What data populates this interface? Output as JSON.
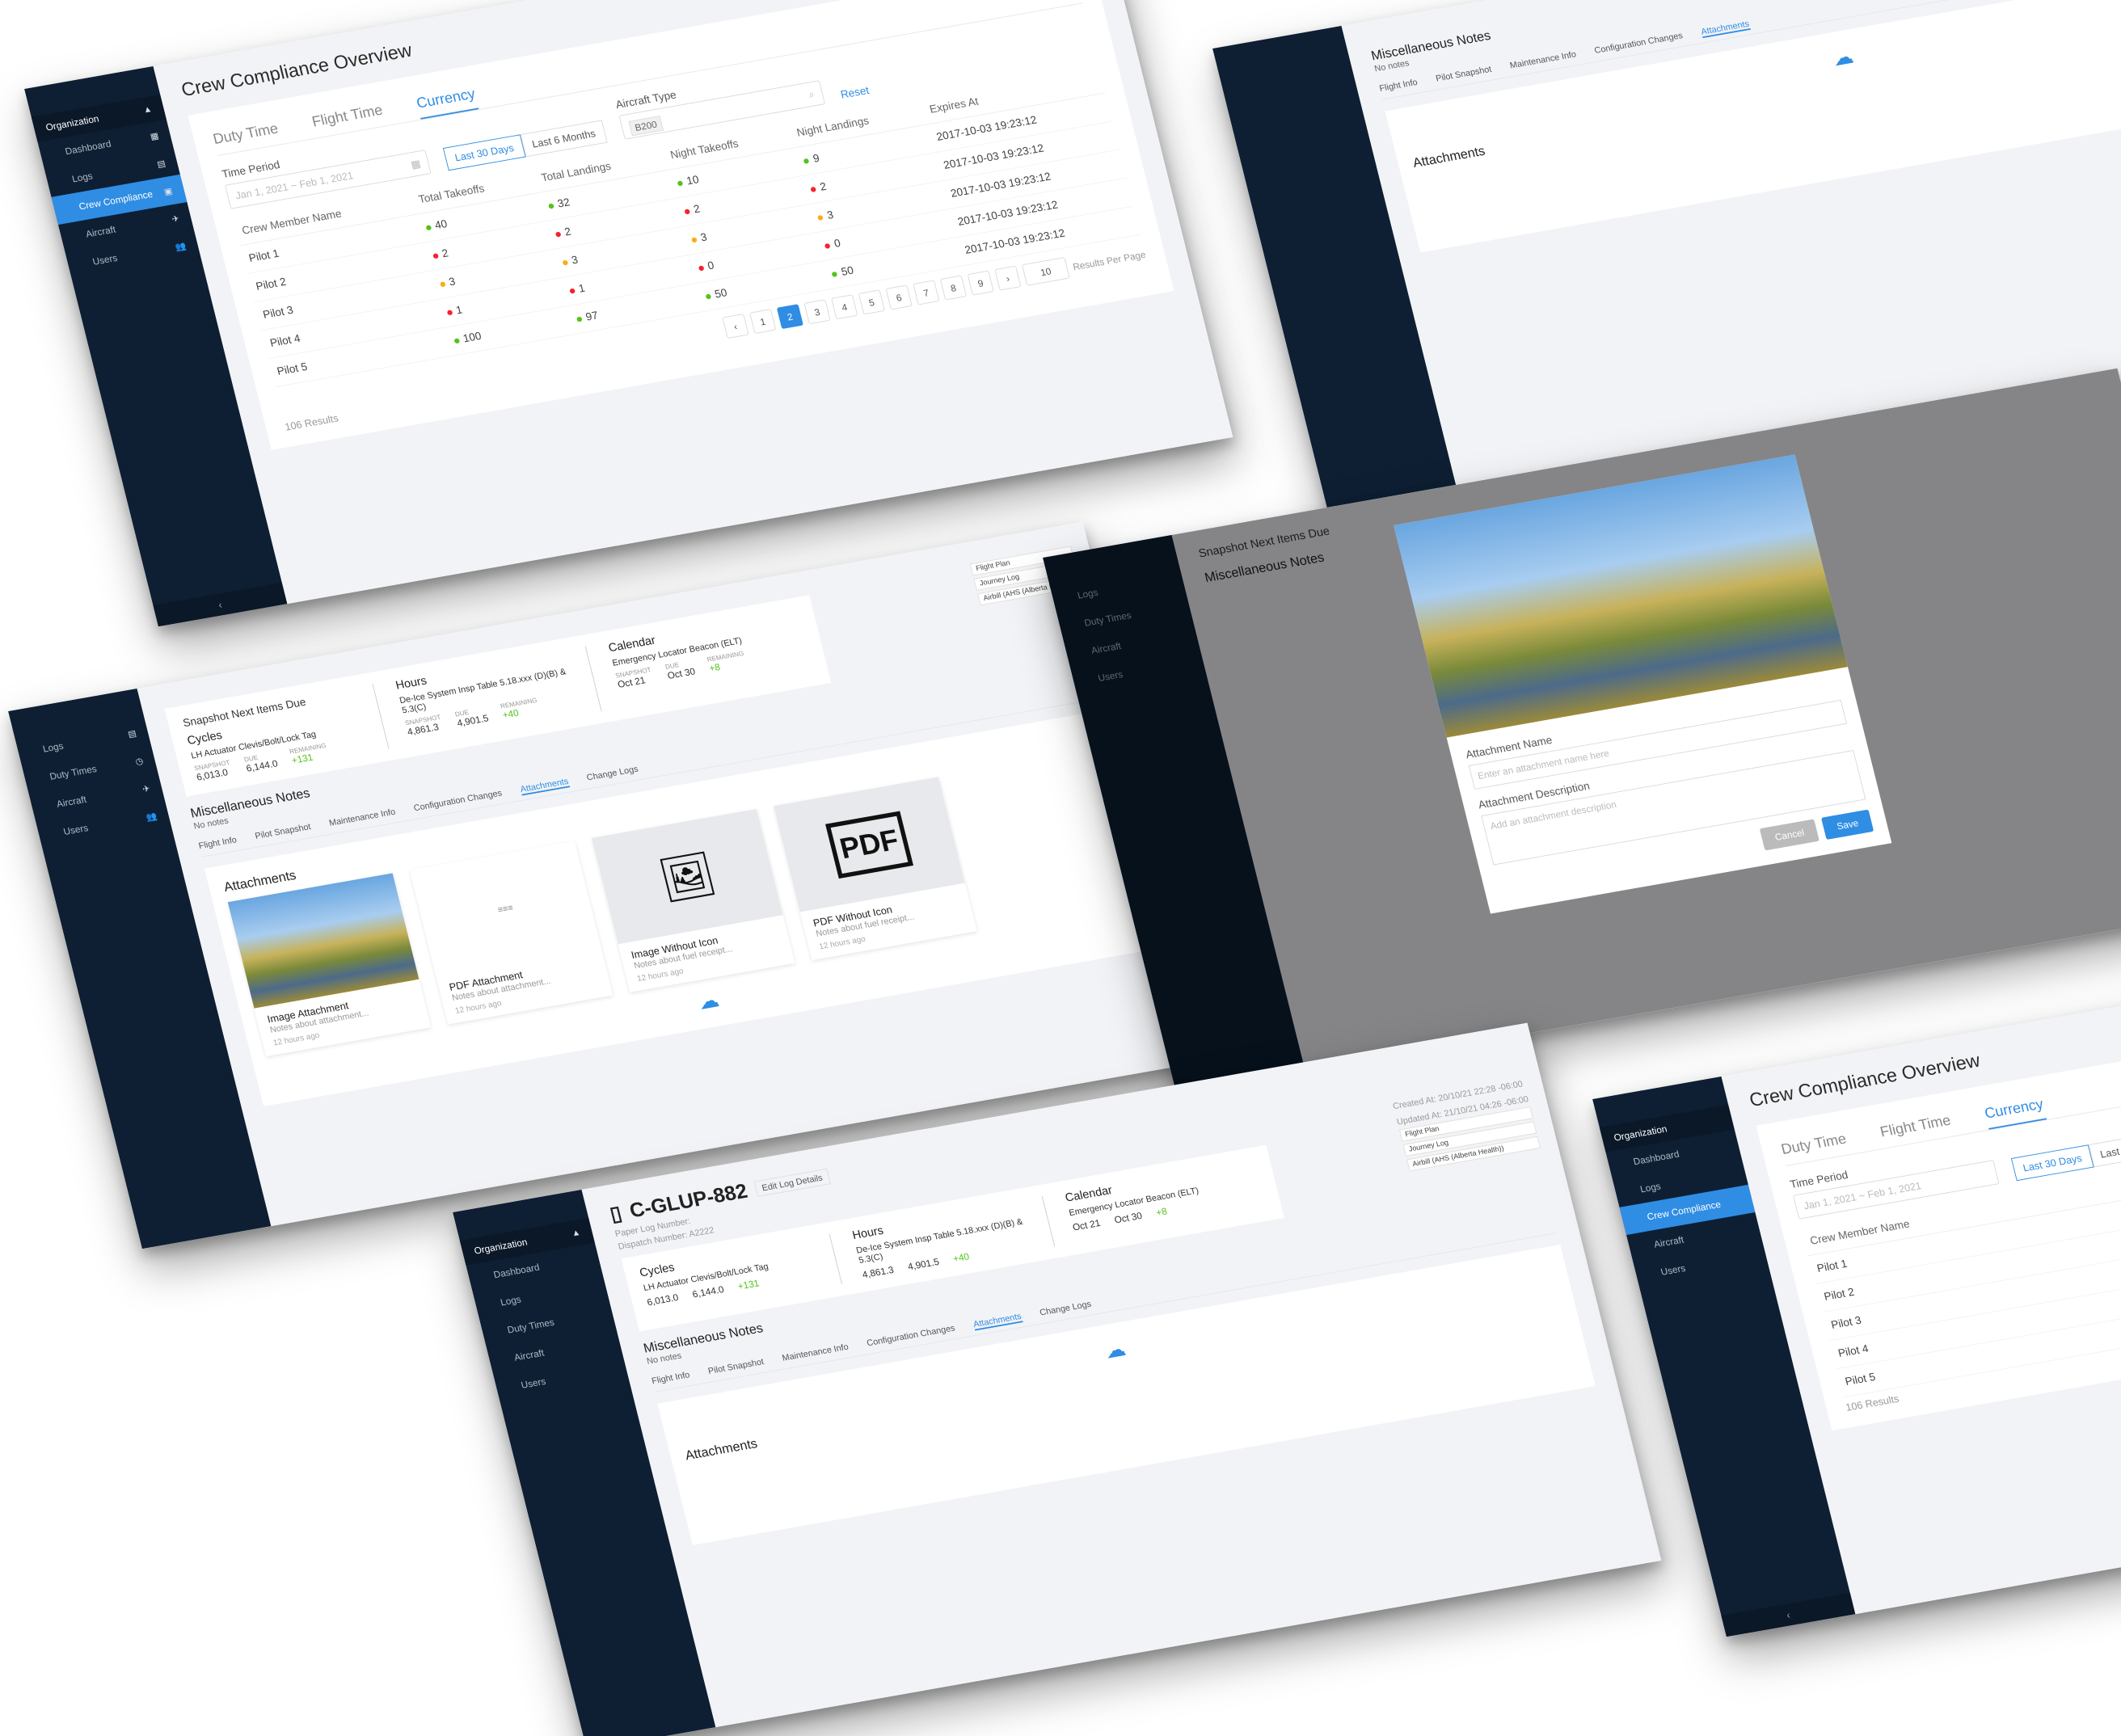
{
  "sidebar": {
    "org": "Organization",
    "items": [
      "Dashboard",
      "Logs",
      "Crew Compliance",
      "Aircraft",
      "Users"
    ],
    "items_log": [
      "Logs",
      "Duty Times",
      "Aircraft",
      "Users"
    ],
    "items_full": [
      "Dashboard",
      "Logs",
      "Duty Times",
      "Aircraft",
      "Users"
    ],
    "collapse": "‹"
  },
  "compliance": {
    "title": "Crew Compliance Overview",
    "tabs": [
      "Duty Time",
      "Flight Time",
      "Currency"
    ],
    "time_period_label": "Time Period",
    "time_period_placeholder": "Jan 1, 2021 ~ Feb 1, 2021",
    "range_options": [
      "Last 30 Days",
      "Last 6 Months"
    ],
    "aircraft_type_label": "Aircraft Type",
    "aircraft_tag": "B200",
    "reset": "Reset",
    "columns": [
      "Crew Member Name",
      "Total Takeoffs",
      "Total Landings",
      "Night Takeoffs",
      "Night Landings",
      "Expires At"
    ],
    "rows": [
      {
        "name": "Pilot 1",
        "takeoffs": "40",
        "tc": "g",
        "landings": "32",
        "lc": "g",
        "nt": "10",
        "ntc": "g",
        "nl": "9",
        "nlc": "g",
        "exp": "2017-10-03 19:23:12"
      },
      {
        "name": "Pilot 2",
        "takeoffs": "2",
        "tc": "r",
        "landings": "2",
        "lc": "r",
        "nt": "2",
        "ntc": "r",
        "nl": "2",
        "nlc": "r",
        "exp": "2017-10-03 19:23:12"
      },
      {
        "name": "Pilot 3",
        "takeoffs": "3",
        "tc": "y",
        "landings": "3",
        "lc": "y",
        "nt": "3",
        "ntc": "y",
        "nl": "3",
        "nlc": "y",
        "exp": "2017-10-03 19:23:12"
      },
      {
        "name": "Pilot 4",
        "takeoffs": "1",
        "tc": "r",
        "landings": "1",
        "lc": "r",
        "nt": "0",
        "ntc": "r",
        "nl": "0",
        "nlc": "r",
        "exp": "2017-10-03 19:23:12"
      },
      {
        "name": "Pilot 5",
        "takeoffs": "100",
        "tc": "g",
        "landings": "97",
        "lc": "g",
        "nt": "50",
        "ntc": "g",
        "nl": "50",
        "nlc": "g",
        "exp": "2017-10-03 19:23:12"
      }
    ],
    "pages": [
      "‹",
      "1",
      "2",
      "3",
      "4",
      "5",
      "6",
      "7",
      "8",
      "9",
      "›"
    ],
    "active_page": "2",
    "per_page": "10",
    "per_page_label": "Results Per Page",
    "results": "106 Results"
  },
  "log": {
    "title": "C-GLUP-882",
    "edit": "Edit Log Details",
    "paper_log": "Paper Log Number:",
    "dispatch": "Dispatch Number: A2222",
    "created": "Created At: 20/10/21 22:28 -06:00",
    "updated": "Updated At: 21/10/21 04:26 -06:00",
    "chips": [
      "Flight Plan",
      "Journey Log",
      "Airbill (AHS (Alberta Health))"
    ],
    "snapshot_title": "Snapshot Next Items Due",
    "cycles": {
      "h": "Cycles",
      "item": "LH Actuator Clevis/Bolt/Lock Tag",
      "snapshot": "6,013.0",
      "due": "6,144.0",
      "remaining": "+131"
    },
    "hours": {
      "h": "Hours",
      "item": "De-Ice System Insp Table 5.18.xxx (D)(B) & 5.3(C)",
      "snapshot": "4,861.3",
      "due": "4,901.5",
      "remaining": "+40"
    },
    "calendar": {
      "h": "Calendar",
      "item": "Emergency Locator Beacon (ELT)",
      "snapshot": "Oct 21",
      "due": "Oct 30",
      "remaining": "+8"
    },
    "lbl_snapshot": "SNAPSHOT",
    "lbl_due": "DUE",
    "lbl_remaining": "REMAINING",
    "notes_h": "Miscellaneous Notes",
    "notes": "No notes",
    "tabs": [
      "Flight Info",
      "Pilot Snapshot",
      "Maintenance Info",
      "Configuration Changes",
      "Attachments",
      "Change Logs"
    ],
    "attachments_h": "Attachments",
    "upload_icon": "cloud-upload-icon",
    "cards": [
      {
        "title": "Image Attachment",
        "desc": "Notes about attachment...",
        "time": "12 hours ago"
      },
      {
        "title": "PDF Attachment",
        "desc": "Notes about attachment...",
        "time": "12 hours ago"
      },
      {
        "title": "Image Without Icon",
        "desc": "Notes about fuel receipt...",
        "time": "12 hours ago"
      },
      {
        "title": "PDF Without Icon",
        "desc": "Notes about fuel receipt...",
        "time": "12 hours ago"
      }
    ],
    "pdf_label": "PDF"
  },
  "modal": {
    "name_label": "Attachment Name",
    "name_placeholder": "Enter an attachment name here",
    "desc_label": "Attachment Description",
    "desc_placeholder": "Add an attachment description",
    "cancel": "Cancel",
    "save": "Save"
  },
  "colors": {
    "accent": "#2f8de4",
    "sidebar": "#0e1f33",
    "green": "#52c41a",
    "red": "#f5222d",
    "yellow": "#faad14"
  }
}
